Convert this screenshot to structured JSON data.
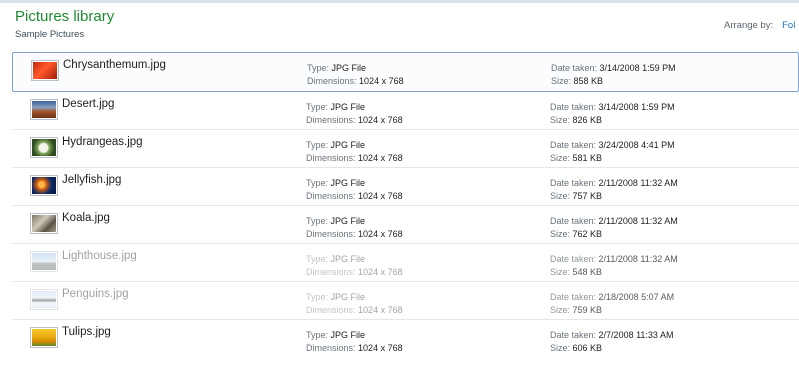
{
  "header": {
    "title": "Pictures library",
    "subtitle": "Sample Pictures",
    "arrange_label": "Arrange by:",
    "arrange_value": "Fol"
  },
  "fields": {
    "type": "Type:",
    "dimensions": "Dimensions:",
    "date_taken": "Date taken:",
    "size": "Size:"
  },
  "files": [
    {
      "name": "Chrysanthemum.jpg",
      "type": "JPG File",
      "dimensions": "1024 x 768",
      "date_taken": "3/14/2008 1:59 PM",
      "size": "858 KB",
      "thumb": "red-flower-thumbnail",
      "state": "selected"
    },
    {
      "name": "Desert.jpg",
      "type": "JPG File",
      "dimensions": "1024 x 768",
      "date_taken": "3/14/2008 1:59 PM",
      "size": "826 KB",
      "thumb": "desert-thumbnail",
      "state": "normal"
    },
    {
      "name": "Hydrangeas.jpg",
      "type": "JPG File",
      "dimensions": "1024 x 768",
      "date_taken": "3/24/2008 4:41 PM",
      "size": "581 KB",
      "thumb": "white-flower-thumbnail",
      "state": "normal"
    },
    {
      "name": "Jellyfish.jpg",
      "type": "JPG File",
      "dimensions": "1024 x 768",
      "date_taken": "2/11/2008 11:32 AM",
      "size": "757 KB",
      "thumb": "jellyfish-thumbnail",
      "state": "normal"
    },
    {
      "name": "Koala.jpg",
      "type": "JPG File",
      "dimensions": "1024 x 768",
      "date_taken": "2/11/2008 11:32 AM",
      "size": "762 KB",
      "thumb": "koala-thumbnail",
      "state": "normal"
    },
    {
      "name": "Lighthouse.jpg",
      "type": "JPG File",
      "dimensions": "1024 x 768",
      "date_taken": "2/11/2008 11:32 AM",
      "size": "548 KB",
      "thumb": "lighthouse-thumbnail",
      "state": "faded"
    },
    {
      "name": "Penguins.jpg",
      "type": "JPG File",
      "dimensions": "1024 x 768",
      "date_taken": "2/18/2008 5:07 AM",
      "size": "759 KB",
      "thumb": "penguins-thumbnail",
      "state": "faded"
    },
    {
      "name": "Tulips.jpg",
      "type": "JPG File",
      "dimensions": "1024 x 768",
      "date_taken": "2/7/2008 11:33 AM",
      "size": "606 KB",
      "thumb": "tulips-thumbnail",
      "state": "normal"
    }
  ],
  "colors": {
    "title_green": "#1f8a2f",
    "link_blue": "#1f6fc2",
    "selection_border": "#7da2ce"
  }
}
